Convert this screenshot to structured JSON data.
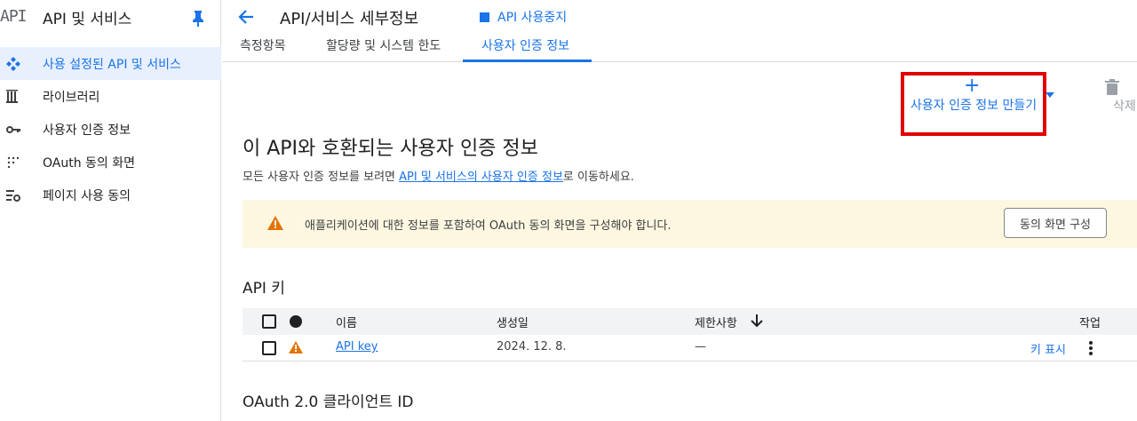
{
  "sidebar": {
    "logo": "API",
    "title": "API 및 서비스",
    "items": [
      {
        "label": "사용 설정된 API 및 서비스",
        "icon": "diamond-grid-icon"
      },
      {
        "label": "라이브러리",
        "icon": "library-icon"
      },
      {
        "label": "사용자 인증 정보",
        "icon": "key-icon"
      },
      {
        "label": "OAuth 동의 화면",
        "icon": "dots-grid-icon"
      },
      {
        "label": "페이지 사용 동의",
        "icon": "settings-list-icon"
      }
    ]
  },
  "header": {
    "title": "API/서비스 세부정보",
    "disable_label": "API 사용중지"
  },
  "tabs": [
    {
      "label": "측정항목"
    },
    {
      "label": "할당량 및 시스템 한도"
    },
    {
      "label": "사용자 인증 정보",
      "active": true
    }
  ],
  "actions": {
    "create_label": "사용자 인증 정보 만들기",
    "delete_label": "삭제"
  },
  "main": {
    "section_title": "이 API와 호환되는 사용자 인증 정보",
    "desc_prefix": "모든 사용자 인증 정보를 보려면 ",
    "desc_link": "API 및 서비스의 사용자 인증 정보",
    "desc_suffix": "로 이동하세요.",
    "banner_text": "애플리케이션에 대한 정보를 포함하여 OAuth 동의 화면을 구성해야 합니다.",
    "banner_button": "동의 화면 구성",
    "api_keys_heading": "API 키",
    "table": {
      "columns": [
        "이름",
        "생성일",
        "제한사항",
        "작업"
      ],
      "rows": [
        {
          "name": "API key",
          "created": "2024. 12. 8.",
          "restrictions": "—",
          "action": "키 표시"
        }
      ]
    },
    "oauth_heading": "OAuth 2.0 클라이언트 ID"
  },
  "colors": {
    "accent": "#1a73e8",
    "warning": "#e37400",
    "highlight_box": "#e00000",
    "banner_bg": "#fef7e0"
  }
}
